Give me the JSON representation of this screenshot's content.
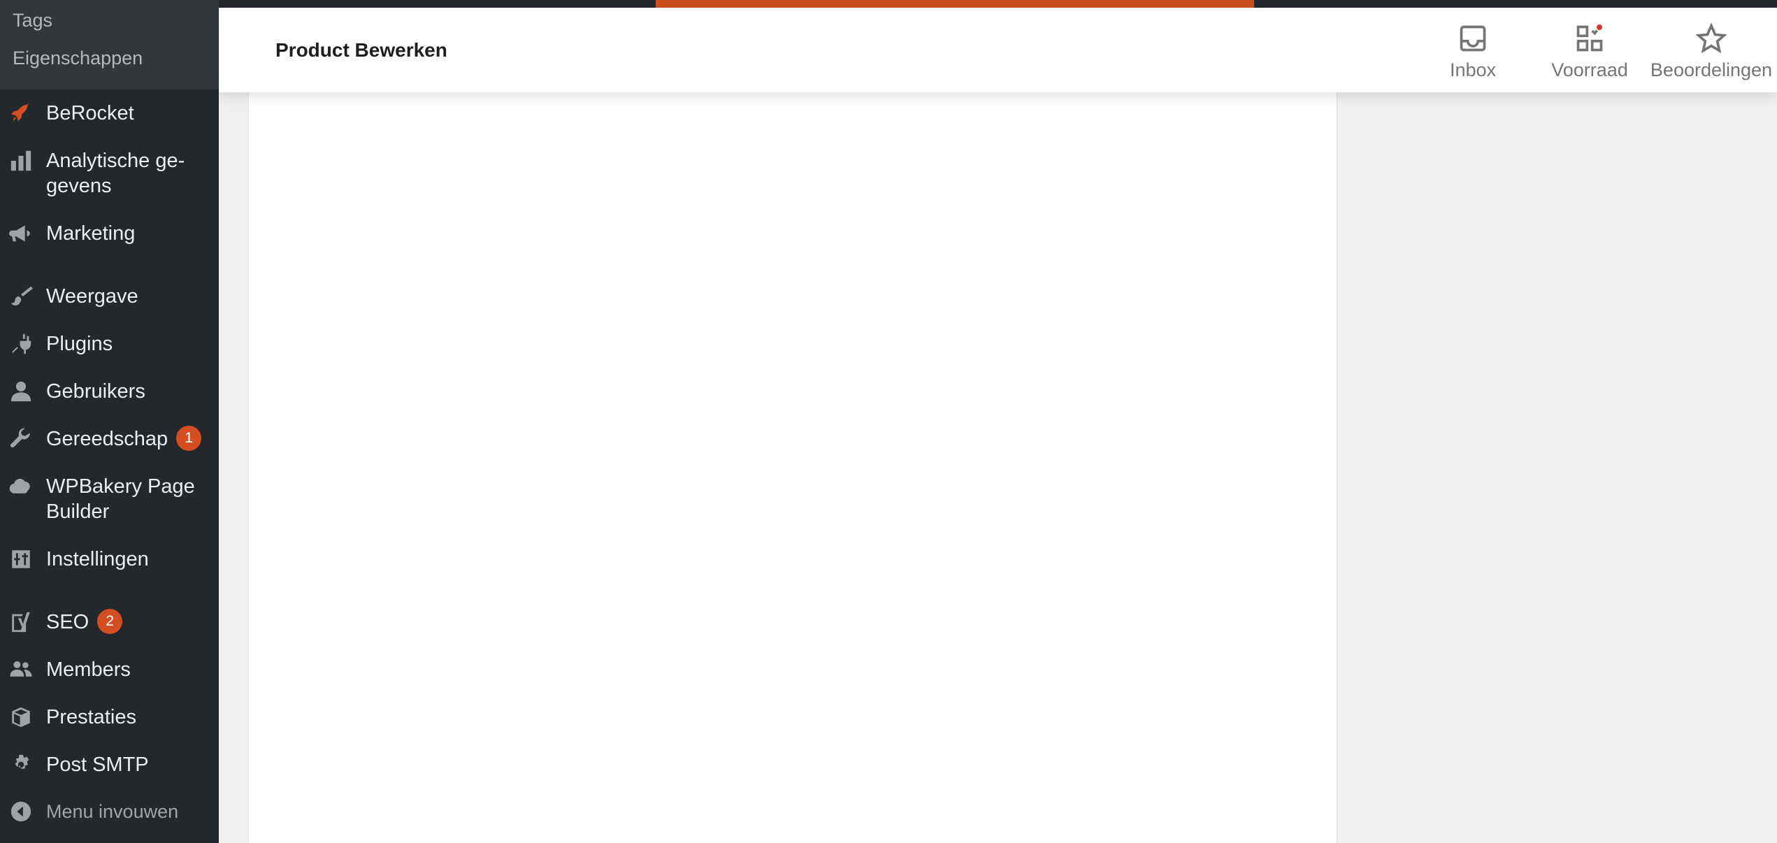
{
  "sidebar": {
    "submenu": [
      "Tags",
      "Eigenschappen"
    ],
    "items": [
      {
        "label": "BeRocket",
        "icon": "rocket-icon"
      },
      {
        "label": "Analytische ge-",
        "label2": "gevens",
        "icon": "bar-chart-icon"
      },
      {
        "label": "Marketing",
        "icon": "megaphone-icon"
      },
      {
        "label": "Weergave",
        "icon": "paintbrush-icon"
      },
      {
        "label": "Plugins",
        "icon": "plug-icon"
      },
      {
        "label": "Gebruikers",
        "icon": "user-icon"
      },
      {
        "label": "Gereedschap",
        "icon": "wrench-icon",
        "badge": "1"
      },
      {
        "label": "WPBakery Page",
        "label2": "Builder",
        "icon": "cloud-icon"
      },
      {
        "label": "Instellingen",
        "icon": "sliders-icon"
      },
      {
        "label": "SEO",
        "icon": "yoast-icon",
        "badge": "2"
      },
      {
        "label": "Members",
        "icon": "users-group-icon"
      },
      {
        "label": "Prestaties",
        "icon": "box-icon"
      },
      {
        "label": "Post SMTP",
        "icon": "gear-icon"
      }
    ],
    "collapse_label": "Menu invouwen"
  },
  "header": {
    "title": "Product Bewerken",
    "buttons": [
      {
        "label": "Inbox",
        "icon": "inbox-icon"
      },
      {
        "label": "Voorraad",
        "icon": "inventory-icon"
      },
      {
        "label": "Beoordelingen",
        "icon": "star-icon"
      }
    ]
  },
  "colors": {
    "accent": "#c9501c",
    "sidebar_bg": "#23282d",
    "badge": "#d54e21"
  }
}
